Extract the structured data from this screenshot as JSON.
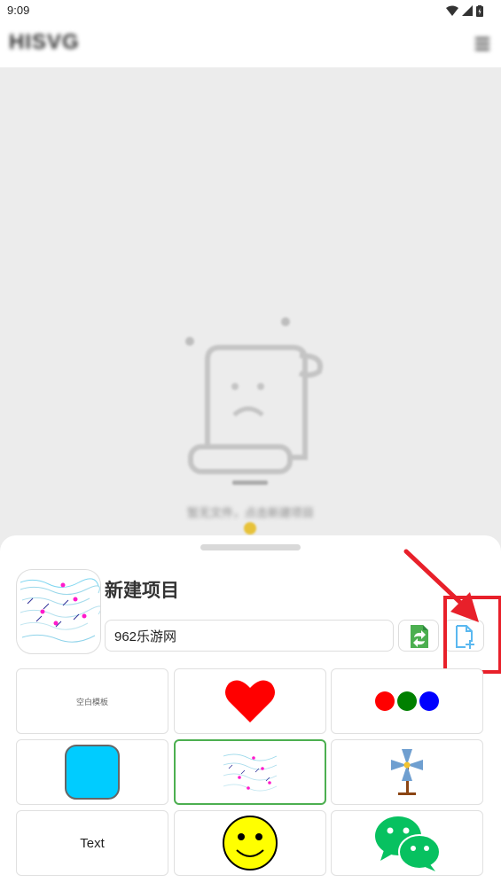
{
  "status_bar": {
    "time": "9:09"
  },
  "app_bar": {
    "title": "HISVG"
  },
  "empty_state": {
    "message": "暂无文件，点击新建项目"
  },
  "sheet": {
    "project_title": "新建项目",
    "name_value": "962乐游网",
    "templates": [
      {
        "label": "空白模板"
      },
      {
        "label": ""
      },
      {
        "label": ""
      },
      {
        "label": ""
      },
      {
        "label": ""
      },
      {
        "label": ""
      },
      {
        "label": "Text"
      },
      {
        "label": ""
      },
      {
        "label": ""
      }
    ]
  },
  "colors": {
    "accent_green": "#4caf50",
    "highlight_red": "#e8202a",
    "new_icon_blue": "#5ab8f0"
  }
}
